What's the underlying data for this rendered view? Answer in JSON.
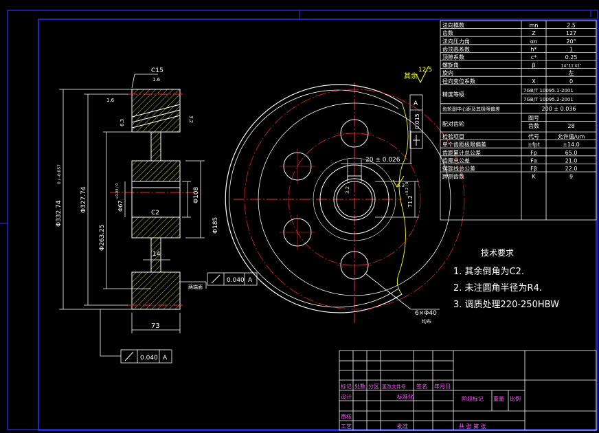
{
  "colors": {
    "background": "#000000",
    "frame": "#2c33ff",
    "line": "#ffffff",
    "center": "#ff2a2a",
    "dim": "#ffffff",
    "hatch": "#ffff33",
    "label": "#ff55ff",
    "grid": "#ffffff"
  },
  "params": {
    "rows": [
      {
        "name": "法向模数",
        "symbol": "mn",
        "value": "2.5"
      },
      {
        "name": "齿数",
        "symbol": "Z",
        "value": "127"
      },
      {
        "name": "法向压力角",
        "symbol": "αn",
        "value": "20°"
      },
      {
        "name": "齿顶高系数",
        "symbol": "h*",
        "value": "1"
      },
      {
        "name": "顶隙系数",
        "symbol": "c*",
        "value": "0.25"
      },
      {
        "name": "螺旋角",
        "symbol": "β",
        "value": "14°11′41″"
      },
      {
        "name": "旋向",
        "symbol": "",
        "value": "左"
      },
      {
        "name": "径向变位系数",
        "symbol": "X",
        "value": "0"
      }
    ],
    "precision_label": "精度等级",
    "precision_values": [
      "7GB/T 10095.1-2001",
      "7GB/T 10095.2-2001"
    ],
    "center_dist_label": "齿轮副中心距及其极限偏差",
    "center_dist_value": "200 ± 0.036",
    "mating_label": "配对齿轮",
    "mating_rows": [
      {
        "symbol": "图号",
        "value": ""
      },
      {
        "symbol": "齿数",
        "value": "28"
      }
    ],
    "inspect_header": {
      "name": "检验项目",
      "symbol": "代号",
      "value": "允许值/um"
    },
    "inspect_rows": [
      {
        "name": "单个齿距极限偏差",
        "symbol": "±fpt",
        "value": "±14.0"
      },
      {
        "name": "齿距累计总公差",
        "symbol": "Fp",
        "value": "65.0"
      },
      {
        "name": "齿廓总公差",
        "symbol": "Fα",
        "value": "21.0"
      },
      {
        "name": "螺旋线总公差",
        "symbol": "Fβ",
        "value": "22.0"
      },
      {
        "name": "跨测齿数",
        "symbol": "K",
        "value": "9"
      }
    ]
  },
  "tech": {
    "title": "技术要求",
    "items": [
      "1. 其余倒角为C2.",
      "2. 未注圆角半径为R4.",
      "3. 调质处理220-250HBW"
    ]
  },
  "section_dims": {
    "chamfer_top": "C15",
    "rough_top": "1.6",
    "rough_left": "1.6",
    "rough_face_a": "6.3",
    "rough_face_b": "3.2",
    "dia_outer": "Φ332.74",
    "dia_outer_tol": "0 / -0.057",
    "dia_pitch": "Φ327.74",
    "dia_web": "Φ263.25",
    "dia_bore": "Φ67",
    "dia_bore_tol": "+0.03 / 0",
    "dia_hub": "Φ108",
    "dia_hub_out": "Φ185",
    "chamfer_inner": "C2",
    "web_width": "14",
    "face_width": "73",
    "both_sides": "两端面",
    "runout_a": "0.040",
    "runout_b": "0.040",
    "datum": "A"
  },
  "front_dims": {
    "rest_rough_label": "其余",
    "rest_rough_value": "12.5",
    "perp_tol": "0.015",
    "datum": "A",
    "keyway_width": "20 ± 0.026",
    "keyway_rough": "3.2",
    "keyway_depth": "71.2",
    "keyway_depth_tol": "+0.2 / 0",
    "hole_rough": "6.3",
    "holes_label": "6×Φ40",
    "holes_note": "均布"
  },
  "title_block": {
    "row1": [
      "标记",
      "处数",
      "分区",
      "更改文件号",
      "签名",
      "年月日"
    ],
    "designer": "设计",
    "standard": "标准化",
    "stage": "阶段标记",
    "weight": "重量",
    "scale": "比例",
    "review": "审核",
    "process": "工艺",
    "approve": "批准",
    "sheet": "共  张  第  张"
  }
}
